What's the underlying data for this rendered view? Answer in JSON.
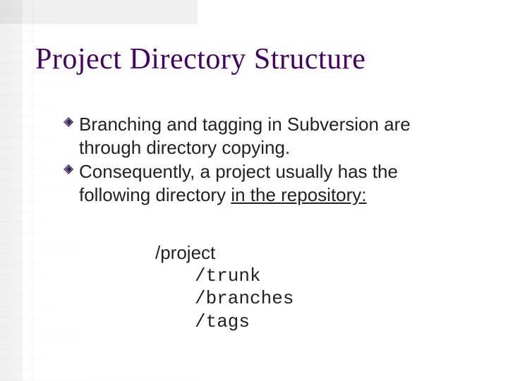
{
  "title": "Project Directory Structure",
  "bullets": [
    {
      "pre": "Branching and tagging in Subversion are through directory copying.",
      "underline": "",
      "post": ""
    },
    {
      "pre": "Consequently, a project usually has the following directory ",
      "underline": "in the repository:",
      "post": ""
    }
  ],
  "code": {
    "root": "/project",
    "children": [
      "/trunk",
      "/branches",
      "/tags"
    ]
  }
}
